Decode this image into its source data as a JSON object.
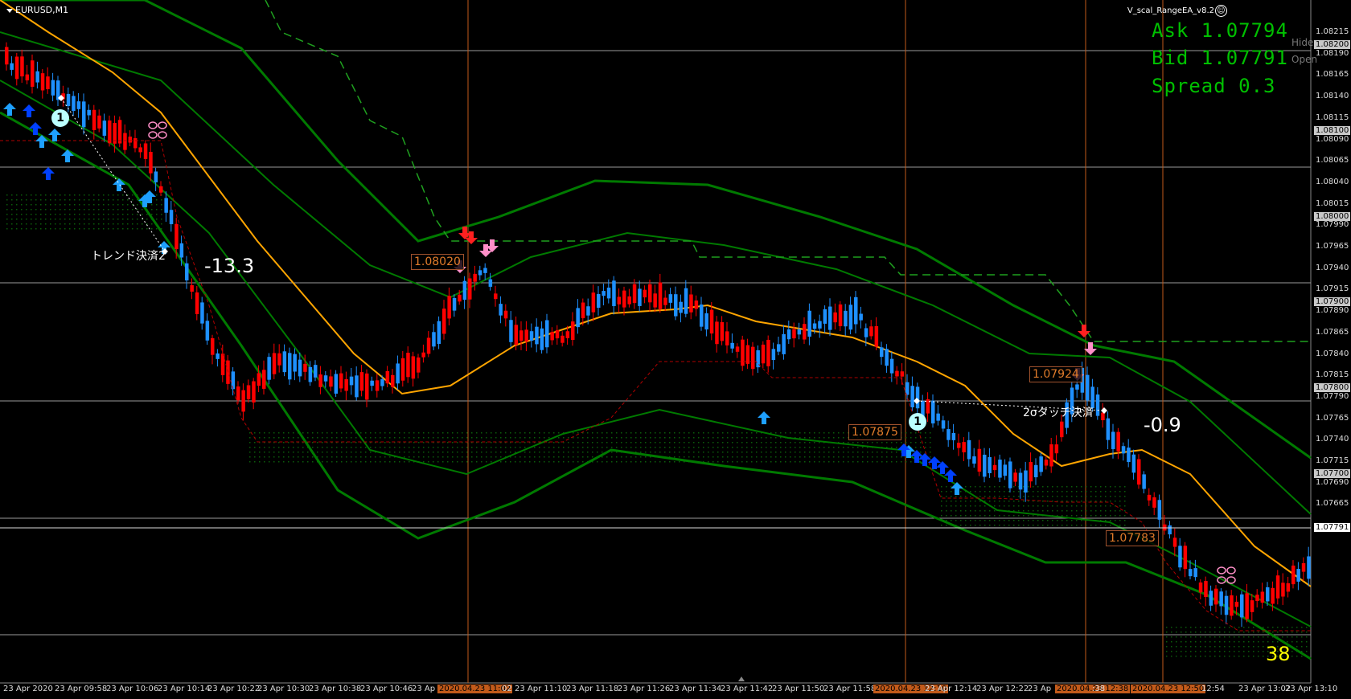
{
  "window": {
    "symbol_title": "EURUSD,M1",
    "ea_name": "V_scal_RangeEA_v8.2",
    "ea_icon": "smiley-icon"
  },
  "info_panel": {
    "ask": "Ask 1.07794",
    "bid": "Bid 1.07791",
    "spread": "Spread 0.3",
    "hide_label": "Hide",
    "open_label": "Open"
  },
  "annotations": {
    "trend_exit_label": "トレンド決済2",
    "trend_exit_pnl": "-13.3",
    "touch_exit_label": "2σタッチ決済",
    "touch_exit_pnl": "-0.9",
    "entry_marker_1": "1",
    "entry_marker_2": "1",
    "price_tag_1": "1.08020",
    "price_tag_2": "1.07875",
    "price_tag_3": "1.07924",
    "price_tag_4": "1.07783",
    "bar_counter": "38"
  },
  "price_axis": {
    "labels": [
      "1.08215",
      "1.08190",
      "1.08165",
      "1.08140",
      "1.08115",
      "1.08090",
      "1.08065",
      "1.08040",
      "1.08015",
      "1.07990",
      "1.07965",
      "1.07940",
      "1.07915",
      "1.07890",
      "1.07865",
      "1.07840",
      "1.07815",
      "1.07790",
      "1.07765",
      "1.07740",
      "1.07715",
      "1.07690",
      "1.07665"
    ],
    "highlighted": [
      "1.08200",
      "1.08100",
      "1.08000",
      "1.07900",
      "1.07800",
      "1.07700"
    ],
    "current_bid": "1.07791"
  },
  "time_axis": {
    "labels": [
      "23 Apr 2020",
      "23 Apr 09:58",
      "23 Apr 10:06",
      "23 Apr 10:14",
      "23 Apr 10:22",
      "23 Apr 10:30",
      "23 Apr 10:38",
      "23 Apr 10:46",
      "23 Ap",
      "2020.04.23 11:02",
      "02",
      "23 Apr 11:10",
      "23 Apr 11:18",
      "23 Apr 11:26",
      "23 Apr 11:34",
      "23 Apr 11:42",
      "23 Apr 11:50",
      "23 Apr 11:58",
      "2020.04.23 12:10",
      "23 Apr 12:14",
      "23 Apr 12:22",
      "23 Ap",
      "2020.04.23 12:38",
      ":38",
      "2020.04.23 12:50",
      "12:54",
      "23 Apr 13:02",
      "23 Apr 13:10"
    ]
  },
  "colors": {
    "background": "#000000",
    "bull_candle": "#1e90ff",
    "bear_candle": "#ff0000",
    "ma_line": "#ffa500",
    "bands": "#007a00",
    "info_text": "#00c000",
    "vertical_marker": "#c25a1a",
    "label_box": "#e07b2a"
  }
}
